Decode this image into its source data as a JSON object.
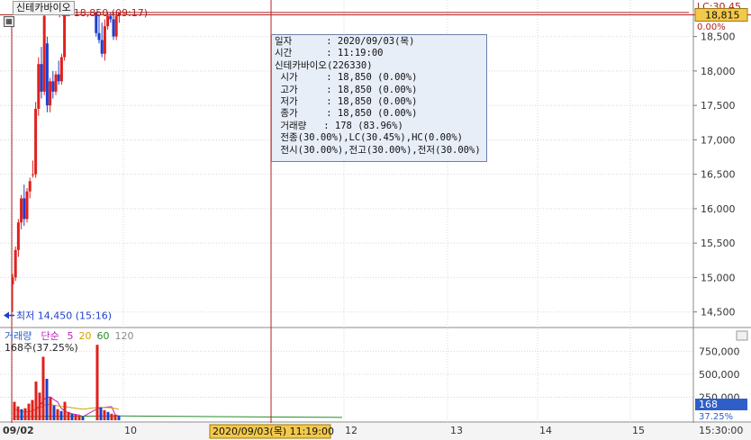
{
  "stock_name": "신테카바이오",
  "high_marker": {
    "text": "최고 18,850 (09:17)",
    "value": 18850
  },
  "low_marker": {
    "text": "최저 14,450 (15:16)",
    "value": 14450
  },
  "lc_label": "LC:30.45",
  "current_price": {
    "value": 18815,
    "text": "18,815"
  },
  "crosshair_time": "2020/09/03(목) 11:19:00",
  "time_axis_right": "15:30:00",
  "tooltip": {
    "rows": [
      "일자      : 2020/09/03(목)",
      "시간      : 11:19:00",
      "신테카바이오(226330)",
      " 시가     : 18,850 (0.00%)",
      " 고가     : 18,850 (0.00%)",
      " 저가     : 18,850 (0.00%)",
      " 종가     : 18,850 (0.00%)",
      " 거래량   : 178 (83.96%)",
      " 전종(30.00%),LC(30.45%),HC(0.00%)",
      " 전시(30.00%),전고(30.00%),전저(30.00%)"
    ]
  },
  "volume_panel": {
    "legend": [
      {
        "text": "거래량",
        "color": "#2e5fc8"
      },
      {
        "text": "단순",
        "color": "#c020c0"
      },
      {
        "text": "5",
        "color": "#c020c0"
      },
      {
        "text": "20",
        "color": "#d4a000"
      },
      {
        "text": "60",
        "color": "#2a8a2a"
      },
      {
        "text": "120",
        "color": "#8a8a8a"
      }
    ],
    "info": "168주(37.25%)",
    "current": {
      "value": 168,
      "text": "168"
    },
    "current_pct": "37.25%"
  },
  "colors": {
    "up": "#e0201c",
    "down": "#1c3fd0",
    "crosshair": "#b02020",
    "grid": "#d8d8d8"
  },
  "chart_data": {
    "type": "candlestick",
    "x_ticks": [
      "09/02",
      "10",
      "12",
      "13",
      "14",
      "15"
    ],
    "y_ticks": [
      14500,
      15000,
      15500,
      16000,
      16500,
      17000,
      17500,
      18000,
      18500
    ],
    "ylim": [
      14300,
      18900
    ],
    "volume_ticks": [
      250000,
      500000,
      750000
    ],
    "volume_ylim": [
      0,
      900000
    ],
    "price_series": [
      {
        "t": 0.0,
        "o": 14900,
        "h": 15050,
        "l": 14500,
        "c": 15000
      },
      {
        "t": 0.8,
        "o": 15000,
        "h": 15450,
        "l": 14950,
        "c": 15400
      },
      {
        "t": 1.6,
        "o": 15400,
        "h": 15850,
        "l": 15300,
        "c": 15800
      },
      {
        "t": 2.4,
        "o": 15800,
        "h": 16200,
        "l": 15700,
        "c": 16150
      },
      {
        "t": 3.2,
        "o": 16150,
        "h": 16350,
        "l": 15750,
        "c": 15850
      },
      {
        "t": 4.0,
        "o": 15850,
        "h": 16300,
        "l": 15800,
        "c": 16250
      },
      {
        "t": 4.8,
        "o": 16250,
        "h": 16450,
        "l": 16150,
        "c": 16400
      },
      {
        "t": 5.6,
        "o": 16500,
        "h": 16700,
        "l": 16450,
        "c": 16500
      },
      {
        "t": 6.4,
        "o": 16500,
        "h": 17550,
        "l": 16450,
        "c": 17450
      },
      {
        "t": 7.2,
        "o": 17450,
        "h": 18200,
        "l": 17350,
        "c": 18100
      },
      {
        "t": 8.0,
        "o": 18100,
        "h": 18350,
        "l": 17600,
        "c": 17700
      },
      {
        "t": 8.8,
        "o": 17700,
        "h": 18850,
        "l": 17650,
        "c": 18800
      },
      {
        "t": 9.6,
        "o": 18400,
        "h": 18500,
        "l": 17400,
        "c": 17500
      },
      {
        "t": 10.4,
        "o": 17500,
        "h": 17900,
        "l": 17400,
        "c": 17850
      },
      {
        "t": 11.2,
        "o": 17850,
        "h": 18000,
        "l": 17600,
        "c": 17700
      },
      {
        "t": 12.0,
        "o": 17700,
        "h": 18000,
        "l": 17650,
        "c": 17950
      },
      {
        "t": 12.8,
        "o": 17950,
        "h": 18150,
        "l": 17800,
        "c": 17850
      },
      {
        "t": 13.6,
        "o": 17850,
        "h": 18250,
        "l": 17800,
        "c": 18200
      },
      {
        "t": 14.4,
        "o": 18200,
        "h": 18850,
        "l": 18150,
        "c": 18800
      },
      {
        "t": 23.2,
        "o": 18850,
        "h": 18850,
        "l": 18500,
        "c": 18550
      },
      {
        "t": 24.0,
        "o": 18550,
        "h": 18800,
        "l": 18400,
        "c": 18450
      },
      {
        "t": 24.8,
        "o": 18450,
        "h": 18700,
        "l": 18200,
        "c": 18250
      },
      {
        "t": 25.6,
        "o": 18250,
        "h": 18750,
        "l": 18150,
        "c": 18650
      },
      {
        "t": 26.4,
        "o": 18650,
        "h": 18850,
        "l": 18600,
        "c": 18800
      },
      {
        "t": 27.2,
        "o": 18800,
        "h": 18850,
        "l": 18700,
        "c": 18750
      },
      {
        "t": 28.0,
        "o": 18750,
        "h": 18850,
        "l": 18450,
        "c": 18500
      },
      {
        "t": 28.8,
        "o": 18500,
        "h": 18850,
        "l": 18450,
        "c": 18800
      },
      {
        "t": 29.6,
        "o": 18800,
        "h": 18850,
        "l": 18700,
        "c": 18850
      }
    ],
    "volume_series": [
      {
        "t": 0.5,
        "v": 200000,
        "up": true
      },
      {
        "t": 1.5,
        "v": 150000,
        "up": true
      },
      {
        "t": 2.5,
        "v": 120000,
        "up": false
      },
      {
        "t": 3.5,
        "v": 130000,
        "up": true
      },
      {
        "t": 4.5,
        "v": 180000,
        "up": true
      },
      {
        "t": 5.5,
        "v": 220000,
        "up": true
      },
      {
        "t": 6.5,
        "v": 420000,
        "up": true
      },
      {
        "t": 7.5,
        "v": 300000,
        "up": true
      },
      {
        "t": 8.5,
        "v": 690000,
        "up": true
      },
      {
        "t": 9.5,
        "v": 450000,
        "up": false
      },
      {
        "t": 10.5,
        "v": 250000,
        "up": true
      },
      {
        "t": 11.5,
        "v": 160000,
        "up": false
      },
      {
        "t": 12.5,
        "v": 120000,
        "up": true
      },
      {
        "t": 13.5,
        "v": 100000,
        "up": false
      },
      {
        "t": 14.5,
        "v": 200000,
        "up": true
      },
      {
        "t": 15.5,
        "v": 90000,
        "up": true
      },
      {
        "t": 16.5,
        "v": 70000,
        "up": false
      },
      {
        "t": 17.5,
        "v": 60000,
        "up": true
      },
      {
        "t": 18.5,
        "v": 50000,
        "up": true
      },
      {
        "t": 19.5,
        "v": 40000,
        "up": false
      },
      {
        "t": 23.5,
        "v": 820000,
        "up": true
      },
      {
        "t": 24.5,
        "v": 140000,
        "up": false
      },
      {
        "t": 25.5,
        "v": 110000,
        "up": true
      },
      {
        "t": 26.5,
        "v": 90000,
        "up": false
      },
      {
        "t": 27.5,
        "v": 70000,
        "up": true
      },
      {
        "t": 28.5,
        "v": 60000,
        "up": true
      },
      {
        "t": 29.5,
        "v": 50000,
        "up": false
      }
    ]
  }
}
